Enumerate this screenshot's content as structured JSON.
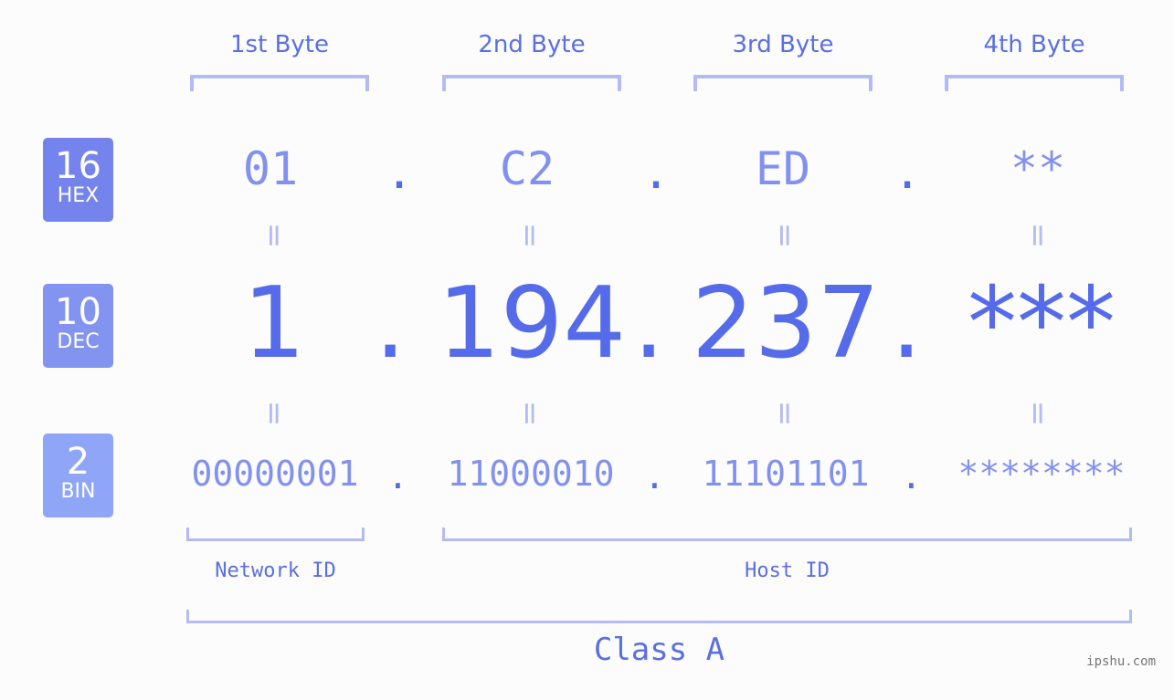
{
  "headers": [
    "1st Byte",
    "2nd Byte",
    "3rd Byte",
    "4th Byte"
  ],
  "badges": {
    "hex": {
      "num": "16",
      "label": "HEX",
      "color": "#7584ec"
    },
    "dec": {
      "num": "10",
      "label": "DEC",
      "color": "#8393f0"
    },
    "bin": {
      "num": "2",
      "label": "BIN",
      "color": "#8fa5f7"
    }
  },
  "hex": [
    "01",
    "C2",
    "ED",
    "**"
  ],
  "dec": [
    "1",
    "194",
    "237",
    "***"
  ],
  "bin": [
    "00000001",
    "11000010",
    "11101101",
    "********"
  ],
  "separator": ".",
  "equals": "=",
  "labels": {
    "network_id": "Network ID",
    "host_id": "Host ID",
    "class": "Class A"
  },
  "watermark": "ipshu.com"
}
